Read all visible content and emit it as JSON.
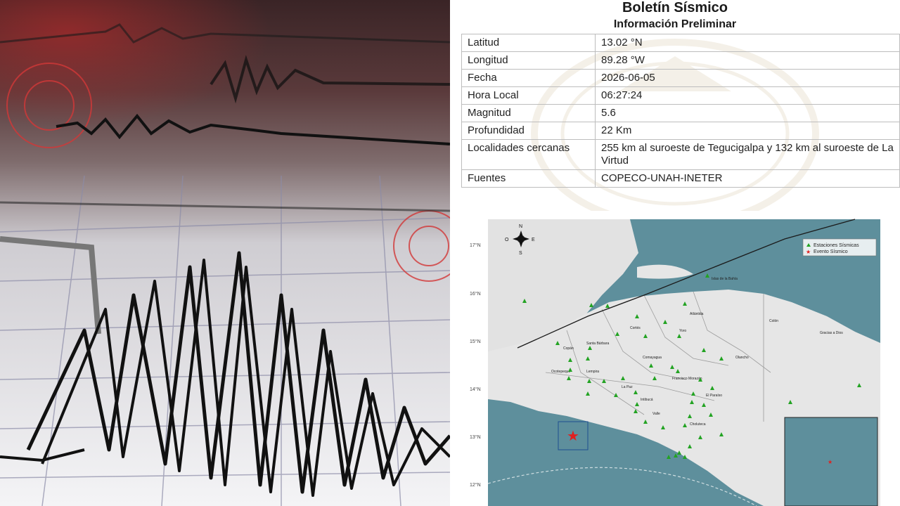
{
  "bulletin": {
    "title": "Boletín Sísmico",
    "subtitle": "Información Preliminar",
    "rows": [
      {
        "label": "Latitud",
        "value": "13.02 °N"
      },
      {
        "label": "Longitud",
        "value": "89.28 °W"
      },
      {
        "label": "Fecha",
        "value": "2026-06-05"
      },
      {
        "label": "Hora Local",
        "value": "06:27:24"
      },
      {
        "label": "Magnitud",
        "value": "5.6"
      },
      {
        "label": "Profundidad",
        "value": "22 Km"
      },
      {
        "label": "Localidades cercanas",
        "value": "255 km al suroeste de Tegucigalpa y 132 km al suroeste de La Virtud"
      },
      {
        "label": "Fuentes",
        "value": "COPECO-UNAH-INETER"
      }
    ]
  },
  "map": {
    "lat_labels": [
      "17°N",
      "16°N",
      "15°N",
      "14°N",
      "13°N",
      "12°N"
    ],
    "compass": {
      "n": "N",
      "s": "S",
      "e": "E",
      "w": "O"
    },
    "legend": {
      "stations": "Estaciones Sísmicas",
      "event": "Evento Sísmico"
    },
    "places": {
      "islas": "Islas de la Bahía",
      "atlantida": "Atlántida",
      "colon": "Colón",
      "gracias": "Gracias a Dios",
      "cortes": "Cortés",
      "yoro": "Yoro",
      "santa_barbara": "Santa Bárbara",
      "copan": "Copán",
      "olancho": "Olancho",
      "comayagua": "Comayagua",
      "ocotepeque": "Ocotepeque",
      "lempira": "Lempira",
      "francisco_morazan": "Francisco Morazán",
      "la_paz": "La Paz",
      "el_paraiso": "El Paraíso",
      "intibuca": "Intibucá",
      "valle": "Valle",
      "choluteca": "Choluteca"
    },
    "colors": {
      "sea": "#5e8f9c",
      "land": "#e6e6e6",
      "station": "#23a323",
      "event": "#e02020"
    }
  }
}
